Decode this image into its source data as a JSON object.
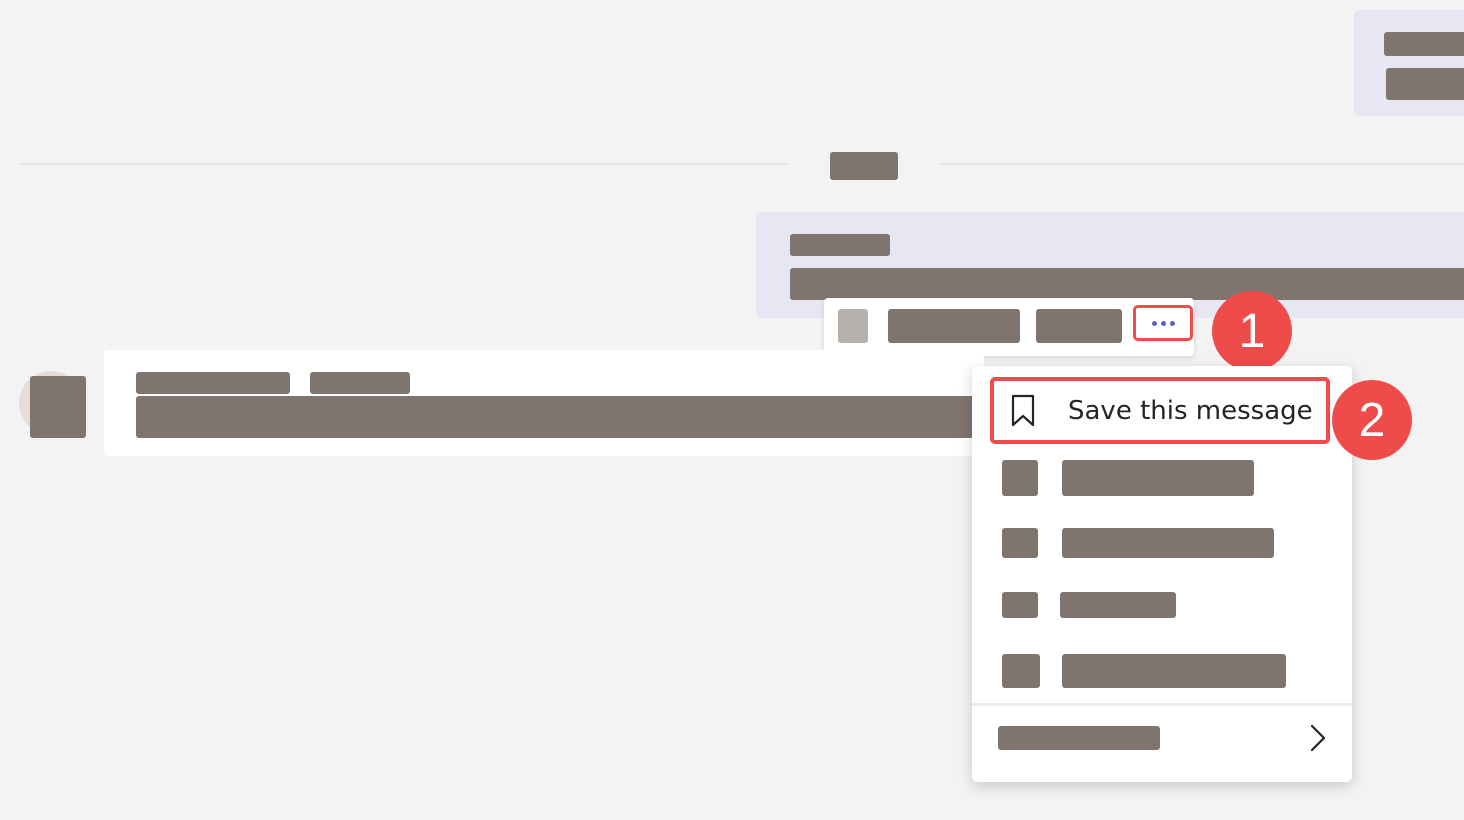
{
  "chat": {
    "more_options_button": {
      "icon": "more-horizontal-icon",
      "accent": "#5b5fc7"
    }
  },
  "context_menu": {
    "save_item": {
      "icon": "bookmark-icon",
      "label": "Save this message"
    },
    "submenu": {
      "icon": "chevron-right-icon"
    }
  },
  "annotations": {
    "step1": "1",
    "step2": "2",
    "highlight_color": "#f04b4b"
  }
}
